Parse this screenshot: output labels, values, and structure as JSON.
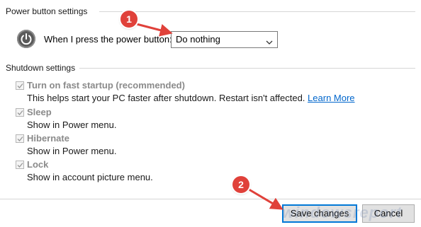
{
  "power_button_settings": {
    "header": "Power button settings",
    "prompt_label": "When I press the power button:",
    "dropdown_value": "Do nothing",
    "icon": "power-icon"
  },
  "shutdown_settings": {
    "header": "Shutdown settings",
    "items": [
      {
        "label": "Turn on fast startup (recommended)",
        "desc": "This helps start your PC faster after shutdown. Restart isn't affected.",
        "link": "Learn More",
        "checked": true
      },
      {
        "label": "Sleep",
        "desc": "Show in Power menu.",
        "checked": true
      },
      {
        "label": "Hibernate",
        "desc": "Show in Power menu.",
        "checked": true
      },
      {
        "label": "Lock",
        "desc": "Show in account picture menu.",
        "checked": true
      }
    ]
  },
  "buttons": {
    "save": "Save changes",
    "cancel": "Cancel"
  },
  "annotations": {
    "marker1": "1",
    "marker2": "2",
    "marker_color": "#e0413a"
  },
  "watermark": "windowsreport"
}
